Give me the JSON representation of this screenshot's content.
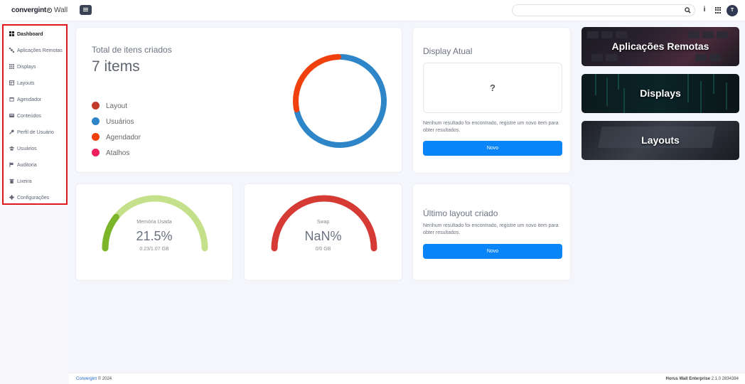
{
  "header": {
    "brand": "convergint",
    "product": "Wall"
  },
  "sidebar": {
    "items": [
      {
        "label": "Dashboard",
        "icon": "dashboard-icon",
        "active": true
      },
      {
        "label": "Aplicações Remotas",
        "icon": "satellite-icon"
      },
      {
        "label": "Displays",
        "icon": "grid-icon"
      },
      {
        "label": "Layouts",
        "icon": "layout-icon"
      },
      {
        "label": "Agendador",
        "icon": "calendar-icon"
      },
      {
        "label": "Conteúdos",
        "icon": "content-icon"
      },
      {
        "label": "Perfil de Usuário",
        "icon": "key-icon"
      },
      {
        "label": "Usuários",
        "icon": "users-icon"
      },
      {
        "label": "Auditoria",
        "icon": "flag-icon"
      },
      {
        "label": "Lixeira",
        "icon": "trash-icon"
      },
      {
        "label": "Configurações",
        "icon": "gear-icon"
      }
    ]
  },
  "total_card": {
    "title": "Total de itens criados",
    "count": "7 items",
    "legend": [
      {
        "label": "Layout",
        "color": "#c0392b"
      },
      {
        "label": "Usuários",
        "color": "#2e86c9"
      },
      {
        "label": "Agendador",
        "color": "#f0400e"
      },
      {
        "label": "Atalhos",
        "color": "#ef1f5e"
      }
    ]
  },
  "chart_data": {
    "type": "pie",
    "categories": [
      "Layout",
      "Usuários",
      "Agendador",
      "Atalhos"
    ],
    "values": [
      0,
      5,
      2,
      0
    ],
    "colors": [
      "#c0392b",
      "#2e86c9",
      "#f0400e",
      "#ef1f5e"
    ]
  },
  "display_atual": {
    "title": "Display Atual",
    "placeholder": "?",
    "message": "Nenhum resultado foi encontrado, registre um novo item para obter resultados.",
    "button": "Novo"
  },
  "ultimo_layout": {
    "title": "Último layout criado",
    "message": "Nenhum resultado foi encontrado, registre um novo item para obter resultados.",
    "button": "Novo"
  },
  "memory": {
    "label": "Memória Usada",
    "value": "21.5%",
    "detail": "0.23/1.07 GB",
    "fraction": 0.215,
    "color": "#7bb52a",
    "track": "#c4e08a"
  },
  "swap": {
    "label": "Swap",
    "value": "NaN%",
    "detail": "0/0 GB",
    "color": "#d63a34"
  },
  "tiles": [
    {
      "label": "Aplicações Remotas"
    },
    {
      "label": "Displays"
    },
    {
      "label": "Layouts"
    }
  ],
  "footer": {
    "brand": "Convergint",
    "copyright": "© 2024",
    "product": "Horus Wall Enterprise",
    "version": "2.1.0 2834384"
  }
}
